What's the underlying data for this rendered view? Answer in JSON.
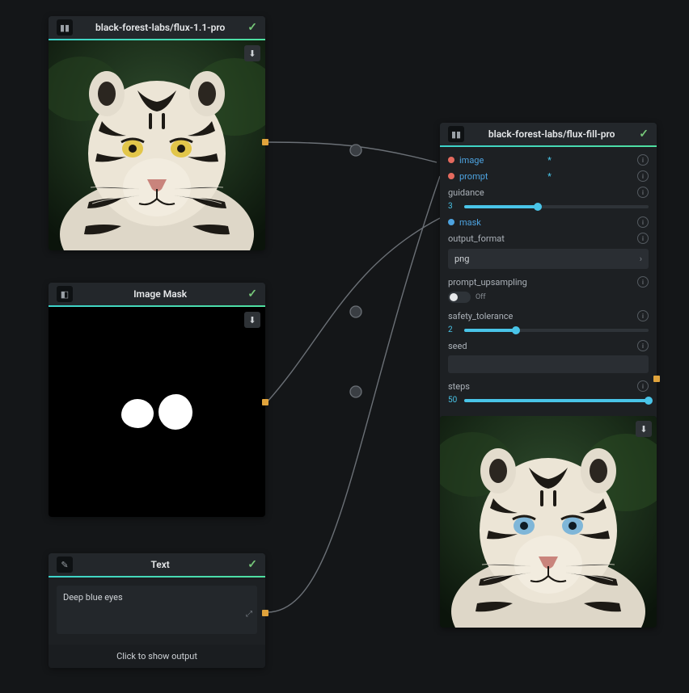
{
  "nodes": {
    "flux11": {
      "title": "black-forest-labs/flux-1.1-pro"
    },
    "mask": {
      "title": "Image Mask"
    },
    "text": {
      "title": "Text",
      "value": "Deep blue eyes",
      "show_output": "Click to show output"
    },
    "fill": {
      "title": "black-forest-labs/flux-fill-pro",
      "params": {
        "image_label": "image",
        "prompt_label": "prompt",
        "guidance_label": "guidance",
        "guidance_value": "3",
        "mask_label": "mask",
        "output_format_label": "output_format",
        "output_format_value": "png",
        "prompt_upsampling_label": "prompt_upsampling",
        "prompt_upsampling_state": "Off",
        "safety_tolerance_label": "safety_tolerance",
        "safety_tolerance_value": "2",
        "seed_label": "seed",
        "steps_label": "steps",
        "steps_value": "50"
      }
    }
  }
}
